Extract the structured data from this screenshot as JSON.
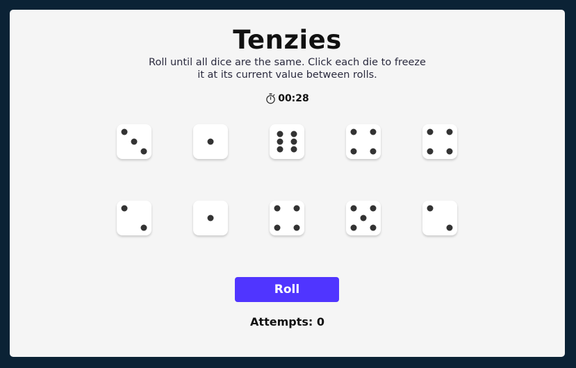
{
  "game": {
    "title": "Tenzies",
    "instructions": "Roll until all dice are the same. Click each die to freeze it at its current value between rolls.",
    "timer": {
      "icon": "stopwatch-icon",
      "value": "00:28"
    },
    "dice": [
      {
        "value": 3,
        "held": false
      },
      {
        "value": 1,
        "held": false
      },
      {
        "value": 6,
        "held": false
      },
      {
        "value": 4,
        "held": false
      },
      {
        "value": 4,
        "held": false
      },
      {
        "value": 2,
        "held": false
      },
      {
        "value": 1,
        "held": false
      },
      {
        "value": 4,
        "held": false
      },
      {
        "value": 5,
        "held": false
      },
      {
        "value": 2,
        "held": false
      }
    ],
    "roll_label": "Roll",
    "attempts_label": "Attempts: 0"
  },
  "colors": {
    "frame": "#0b2235",
    "board": "#f5f5f5",
    "die_face": "#ffffff",
    "pip": "#333333",
    "button": "#5035ff",
    "button_text": "#ffffff"
  }
}
